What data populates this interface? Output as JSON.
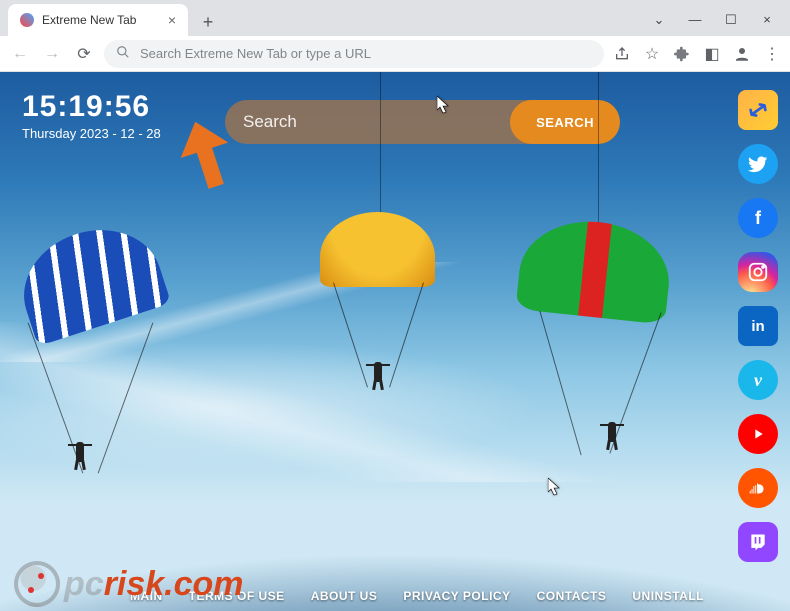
{
  "browser": {
    "tab_title": "Extreme New Tab",
    "omnibox_placeholder": "Search Extreme New Tab or type a URL"
  },
  "clock": {
    "time": "15:19:56",
    "date": "Thursday 2023 - 12 - 28"
  },
  "search": {
    "placeholder": "Search",
    "button": "SEARCH"
  },
  "rail": [
    {
      "name": "swap-icon",
      "glyph": "⇅"
    },
    {
      "name": "twitter-icon",
      "glyph": "𝕏"
    },
    {
      "name": "facebook-icon",
      "glyph": "f"
    },
    {
      "name": "instagram-icon",
      "glyph": "◉"
    },
    {
      "name": "linkedin-icon",
      "glyph": "in"
    },
    {
      "name": "vimeo-icon",
      "glyph": "v"
    },
    {
      "name": "youtube-icon",
      "glyph": "▶"
    },
    {
      "name": "soundcloud-icon",
      "glyph": "☁"
    },
    {
      "name": "twitch-icon",
      "glyph": "⎚"
    }
  ],
  "footer": {
    "items": [
      "MAIN",
      "TERMS OF USE",
      "ABOUT US",
      "PRIVACY POLICY",
      "CONTACTS",
      "UNINSTALL"
    ]
  },
  "watermark": {
    "prefix": "pc",
    "suffix": "risk.com"
  }
}
